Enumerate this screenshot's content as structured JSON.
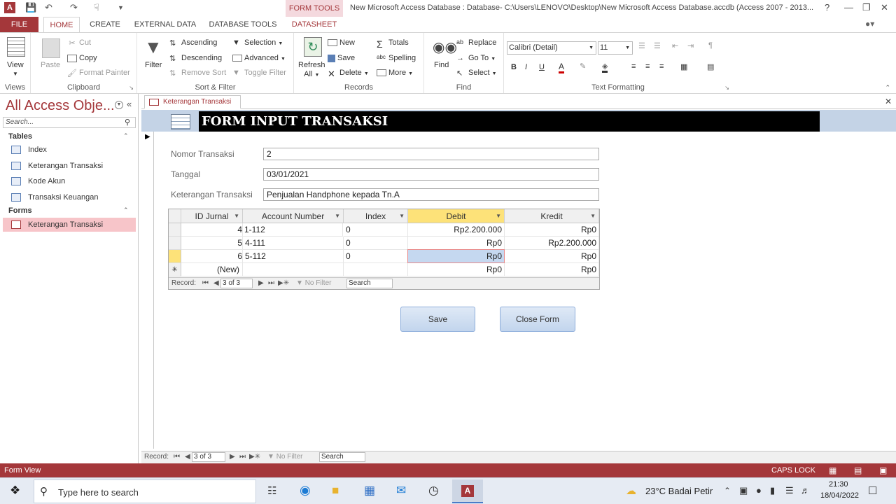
{
  "titlebar": {
    "context_group": "FORM TOOLS",
    "title": "New Microsoft Access Database : Database- C:\\Users\\LENOVO\\Desktop\\New Microsoft Access Database.accdb (Access 2007 - 2013...",
    "help": "?"
  },
  "tabs": [
    "FILE",
    "HOME",
    "CREATE",
    "EXTERNAL DATA",
    "DATABASE TOOLS",
    "DATASHEET"
  ],
  "ribbon": {
    "views": {
      "label": "Views",
      "view": "View"
    },
    "clipboard": {
      "label": "Clipboard",
      "paste": "Paste",
      "cut": "Cut",
      "copy": "Copy",
      "format_painter": "Format Painter"
    },
    "sort_filter": {
      "label": "Sort & Filter",
      "filter": "Filter",
      "ascending": "Ascending",
      "descending": "Descending",
      "remove_sort": "Remove Sort",
      "selection": "Selection",
      "advanced": "Advanced",
      "toggle_filter": "Toggle Filter"
    },
    "records": {
      "label": "Records",
      "refresh": "Refresh",
      "refresh_all": "All",
      "new": "New",
      "save": "Save",
      "delete": "Delete",
      "totals": "Totals",
      "spelling": "Spelling",
      "more": "More"
    },
    "find": {
      "label": "Find",
      "find": "Find",
      "replace": "Replace",
      "goto": "Go To",
      "select": "Select"
    },
    "text_formatting": {
      "label": "Text Formatting",
      "font": "Calibri (Detail)",
      "size": "11",
      "bold": "B",
      "italic": "I",
      "underline": "U"
    }
  },
  "nav_pane": {
    "title": "All Access Obje...",
    "search_placeholder": "Search...",
    "sections": [
      {
        "name": "Tables",
        "items": [
          "Index",
          "Keterangan Transaksi",
          "Kode Akun",
          "Transaksi Keuangan"
        ]
      },
      {
        "name": "Forms",
        "items": [
          "Keterangan Transaksi"
        ]
      }
    ]
  },
  "document_tab": "Keterangan Transaksi",
  "form": {
    "title": "FORM INPUT TRANSAKSI",
    "fields": [
      {
        "label": "Nomor Transaksi",
        "value": "2"
      },
      {
        "label": "Tanggal",
        "value": "03/01/2021"
      },
      {
        "label": "Keterangan Transaksi",
        "value": "Penjualan Handphone kepada Tn.A"
      }
    ],
    "subgrid": {
      "columns": [
        "ID Jurnal",
        "Account Number",
        "Index",
        "Debit",
        "Kredit"
      ],
      "rows": [
        {
          "id": "4",
          "account": "1-112",
          "index": "0",
          "debit": "Rp2.200.000",
          "kredit": "Rp0"
        },
        {
          "id": "5",
          "account": "4-111",
          "index": "0",
          "debit": "Rp0",
          "kredit": "Rp2.200.000"
        },
        {
          "id": "6",
          "account": "5-112",
          "index": "0",
          "debit": "Rp0",
          "kredit": "Rp0"
        }
      ],
      "new_row": {
        "id": "(New)",
        "debit": "Rp0",
        "kredit": "Rp0"
      },
      "nav": {
        "record_label": "Record:",
        "position": "3 of 3",
        "no_filter": "No Filter",
        "search": "Search"
      }
    },
    "buttons": {
      "save": "Save",
      "close": "Close Form"
    }
  },
  "main_nav": {
    "record_label": "Record:",
    "position": "3 of 3",
    "no_filter": "No Filter",
    "search": "Search"
  },
  "statusbar": {
    "left": "Form View",
    "caps": "CAPS LOCK"
  },
  "taskbar": {
    "search_placeholder": "Type here to search",
    "weather": "23°C  Badai Petir",
    "time": "21:30",
    "date": "18/04/2022"
  }
}
